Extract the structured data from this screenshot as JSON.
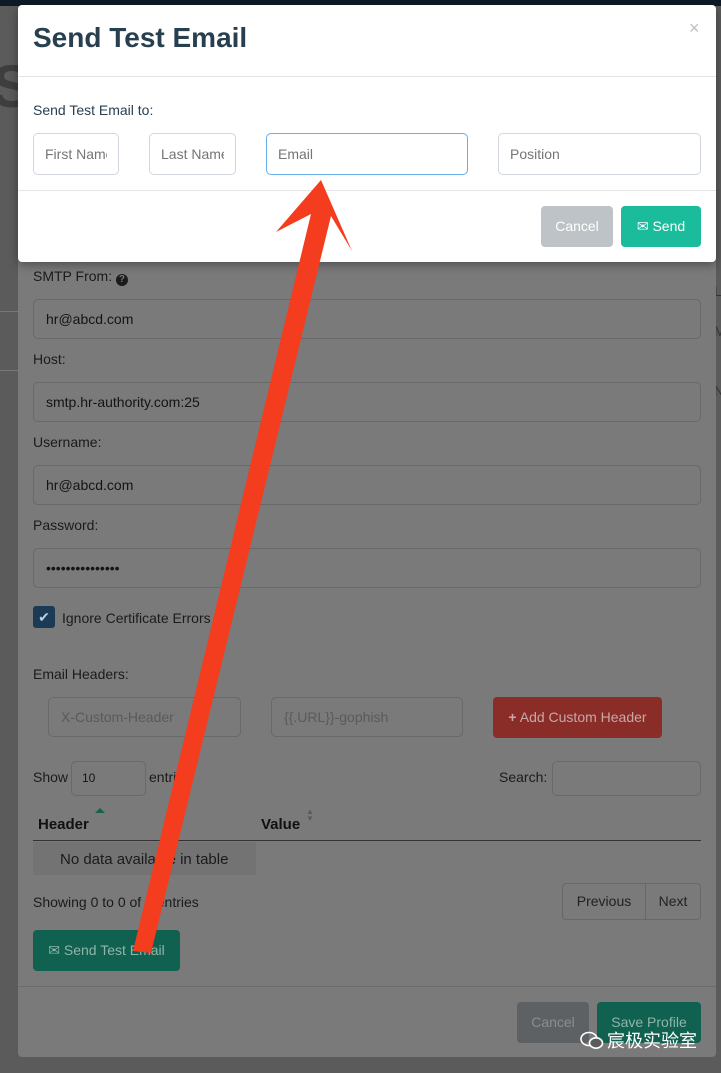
{
  "test_email_modal": {
    "title": "Send Test Email",
    "close": "×",
    "to_label": "Send Test Email to:",
    "first_name_placeholder": "First Name",
    "last_name_placeholder": "Last Name",
    "email_placeholder": "Email",
    "position_placeholder": "Position",
    "cancel_label": "Cancel",
    "send_label": "Send"
  },
  "profile_modal": {
    "smtp_from_label": "SMTP From:",
    "smtp_from_value": "hr@abcd.com",
    "host_label": "Host:",
    "host_value": "smtp.hr-authority.com:25",
    "username_label": "Username:",
    "username_value": "hr@abcd.com",
    "password_label": "Password:",
    "password_value": "•••••••••••••••",
    "ignore_cert_label": "Ignore Certificate Errors",
    "ignore_cert_checked": true,
    "email_headers_label": "Email Headers:",
    "header_placeholder": "X-Custom-Header",
    "value_placeholder": "{{.URL}}-gophish",
    "add_header_label": "Add Custom Header",
    "show_label": "Show",
    "entries_value": "10",
    "entries_label": "entries",
    "search_label": "Search:",
    "table": {
      "columns": [
        "Header",
        "Value"
      ],
      "empty_message": "No data available in table"
    },
    "showing_text": "Showing 0 to 0 of 0 entries",
    "previous_label": "Previous",
    "next_label": "Next",
    "send_test_email_label": "Send Test Email",
    "cancel_label": "Cancel",
    "save_profile_label": "Save Profile"
  },
  "watermark": "宸极实验室",
  "colors": {
    "send_green": "#1abc9c",
    "cancel_gray": "#bdc3c7",
    "arrow_red": "#f43c1f",
    "add_header_red": "#8a2d28",
    "title_color": "#283f50"
  },
  "icons": [
    "envelope-icon",
    "plus-icon",
    "check-icon",
    "question-circle-icon",
    "sort-icon",
    "wechat-icon"
  ]
}
